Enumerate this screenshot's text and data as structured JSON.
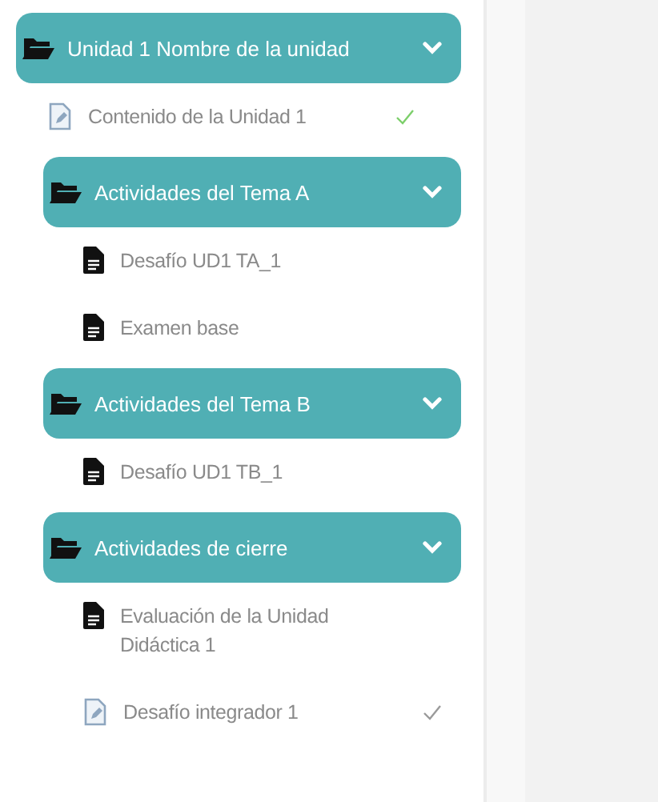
{
  "section": {
    "title": "Unidad 1 Nombre de la unidad",
    "expanded": true,
    "children": [
      {
        "kind": "page",
        "label": "Contenido de la Unidad 1",
        "color": "#7ccf6a"
      },
      {
        "kind": "folder",
        "title": "Actividades del Tema A",
        "expanded": true,
        "children": [
          {
            "kind": "file",
            "label": "Desafío UD1 TA_1"
          },
          {
            "kind": "file",
            "label": "Examen base"
          }
        ]
      },
      {
        "kind": "folder",
        "title": "Actividades del Tema B",
        "expanded": true,
        "children": [
          {
            "kind": "file",
            "label": "Desafío UD1 TB_1"
          }
        ]
      },
      {
        "kind": "folder",
        "title": "Actividades de cierre",
        "expanded": true,
        "children": [
          {
            "kind": "file",
            "label": "Evaluación de la Unidad Didáctica 1"
          },
          {
            "kind": "page",
            "label": "Desafío integrador 1",
            "color": "#9a9a9a"
          }
        ]
      }
    ]
  }
}
